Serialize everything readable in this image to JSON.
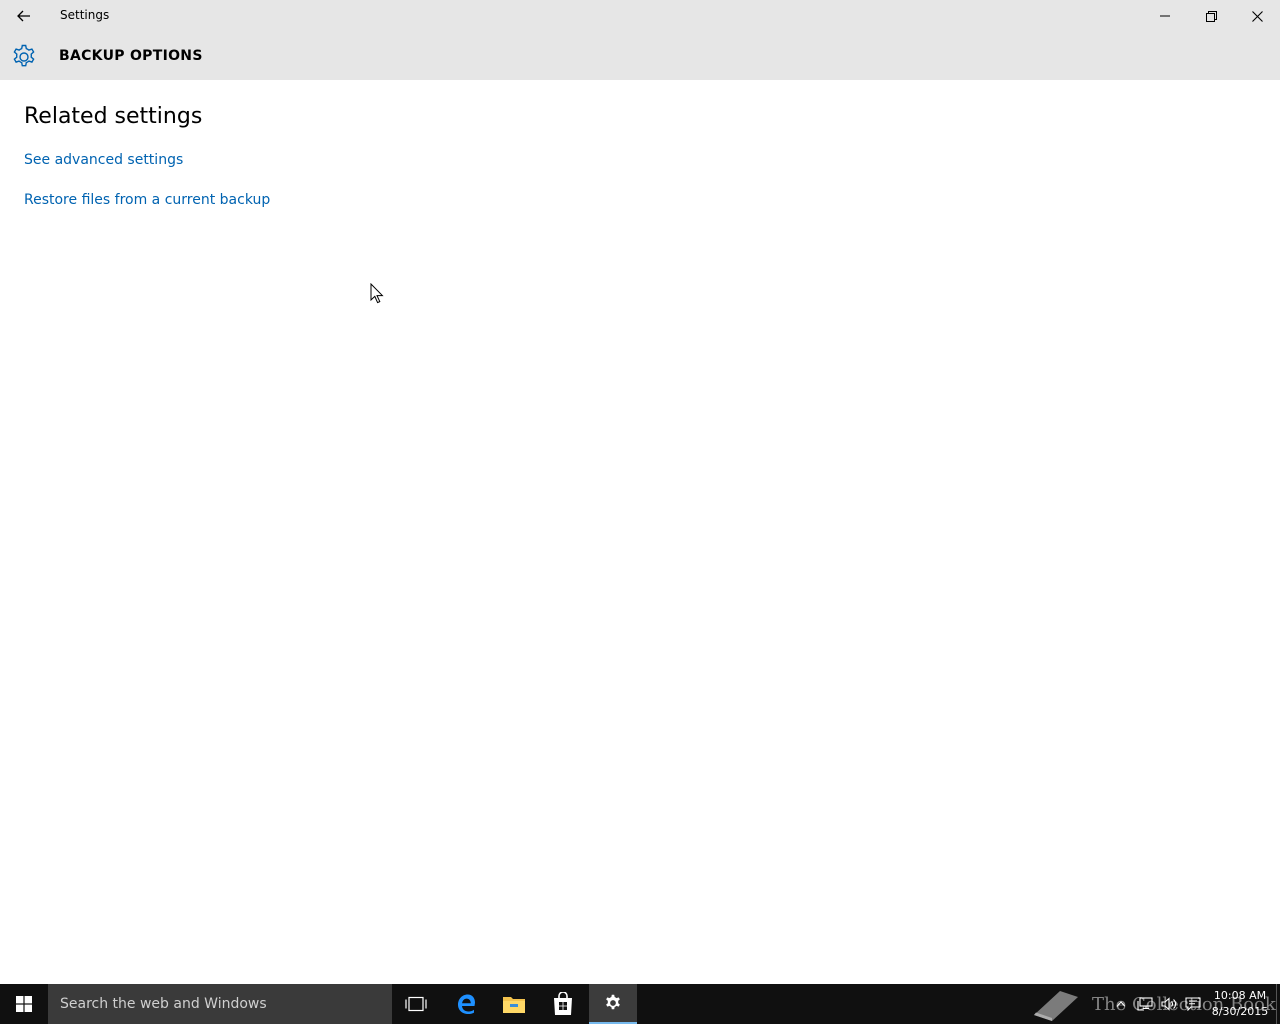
{
  "window": {
    "app_title": "Settings",
    "header_title": "BACKUP OPTIONS"
  },
  "content": {
    "section_title": "Related settings",
    "links": [
      {
        "label": "See advanced settings"
      },
      {
        "label": "Restore files from a current backup"
      }
    ]
  },
  "taskbar": {
    "search_placeholder": "Search the web and Windows",
    "watermark": "The Collection Book",
    "clock_time": "10:08 AM",
    "clock_date": "8/30/2015"
  },
  "colors": {
    "link": "#0063b1",
    "chrome": "#e6e6e6",
    "gear_accent": "#0063b1",
    "taskbar": "#101010",
    "active_indicator": "#76b9ed"
  },
  "icons": {
    "back": "arrow-left-icon",
    "header": "gear-icon",
    "minimize": "minimize-icon",
    "restore": "restore-icon",
    "close": "close-icon",
    "start": "windows-logo-icon",
    "task_view": "task-view-icon",
    "edge": "edge-icon",
    "explorer": "folder-icon",
    "store": "store-icon",
    "settings": "gear-icon"
  }
}
